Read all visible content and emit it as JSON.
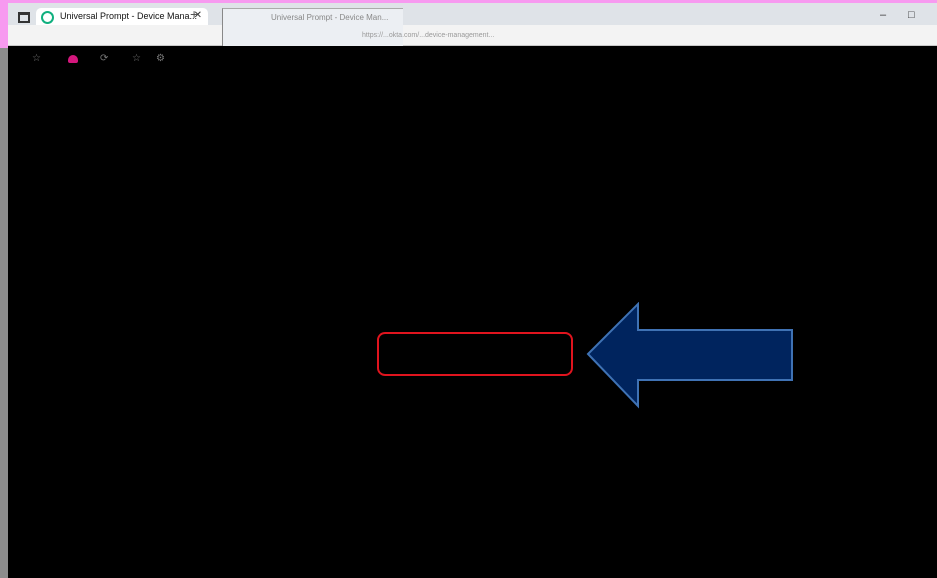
{
  "browser": {
    "active_tab": {
      "title": "Universal Prompt - Device Mana..."
    },
    "background_tab": {
      "title": "Universal Prompt - Device Man..."
    },
    "address_bar": {
      "url": "https://...okta.com/...device-management..."
    },
    "window_controls": {
      "minimize": "–",
      "maximize": "□",
      "close": "✕"
    },
    "new_tab": "+",
    "tab_close": "✕"
  },
  "annotation": {
    "box_color": "#e0141e",
    "arrow_fill": "#00245e",
    "arrow_stroke": "#3f72b4",
    "arrow_direction": "left"
  },
  "colors": {
    "background": "#000000",
    "accent_pink": "#f79af0"
  }
}
